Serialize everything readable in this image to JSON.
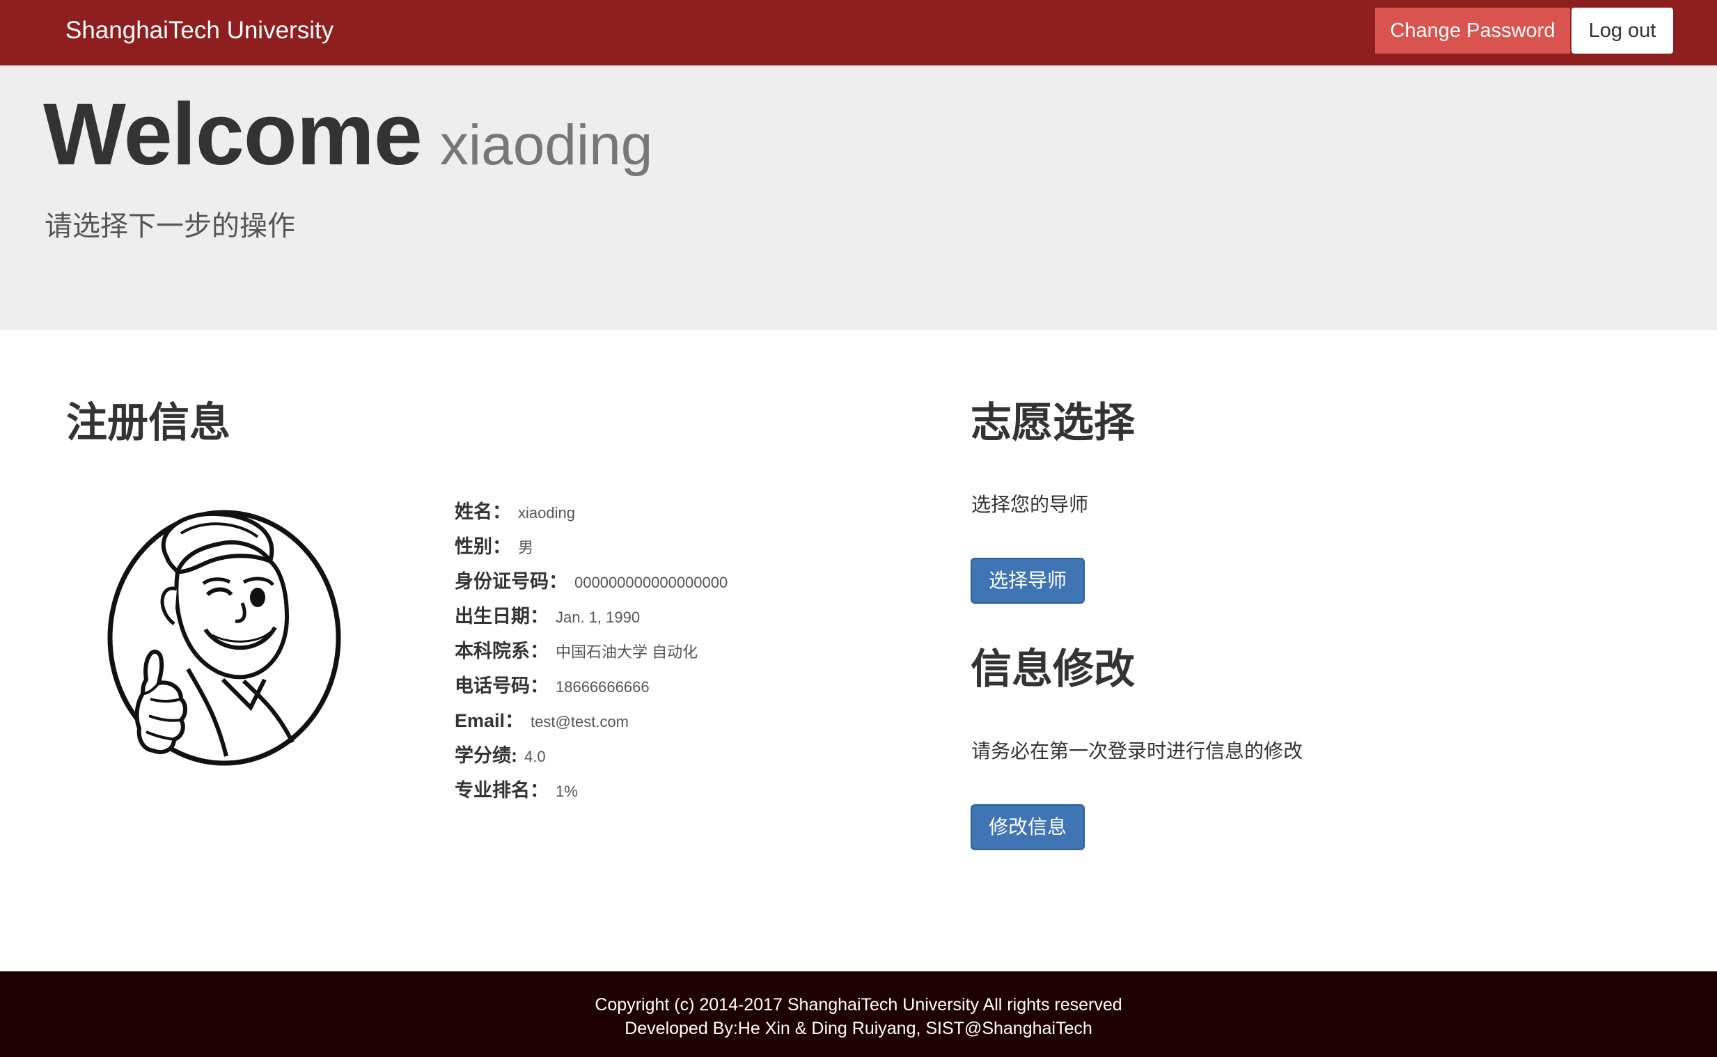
{
  "navbar": {
    "brand": "ShanghaiTech University",
    "change_password": "Change Password",
    "logout": "Log out"
  },
  "jumbotron": {
    "welcome": "Welcome",
    "username": "xiaoding",
    "subtitle": "请选择下一步的操作"
  },
  "registration": {
    "title": "注册信息",
    "avatar_icon": "vault-boy-thumbs-up",
    "fields": [
      {
        "label": "姓名：",
        "value": "xiaoding"
      },
      {
        "label": "性别：",
        "value": "男"
      },
      {
        "label": "身份证号码：",
        "value": "000000000000000000"
      },
      {
        "label": "出生日期：",
        "value": "Jan. 1, 1990"
      },
      {
        "label": "本科院系：",
        "value": "中国石油大学 自动化"
      },
      {
        "label": "电话号码：",
        "value": "18666666666"
      },
      {
        "label": "Email：",
        "value": "test@test.com"
      },
      {
        "label": "学分绩:",
        "value": "4.0"
      },
      {
        "label": "专业排名：",
        "value": "1%"
      }
    ]
  },
  "preference": {
    "title": "志愿选择",
    "text": "选择您的导师",
    "button": "选择导师"
  },
  "modify": {
    "title": "信息修改",
    "text": "请务必在第一次登录时进行信息的修改",
    "button": "修改信息"
  },
  "footer": {
    "copyright": "Copyright (c) 2014-2017 ShanghaiTech University All rights reserved",
    "developed": "Developed By:He Xin & Ding Ruiyang, SIST@ShanghaiTech"
  },
  "colors": {
    "navbar": "#8f1f1e",
    "danger": "#d9534f",
    "primary": "#3f74b5",
    "jumbotron": "#eeeeee",
    "footer": "#1f0000"
  }
}
